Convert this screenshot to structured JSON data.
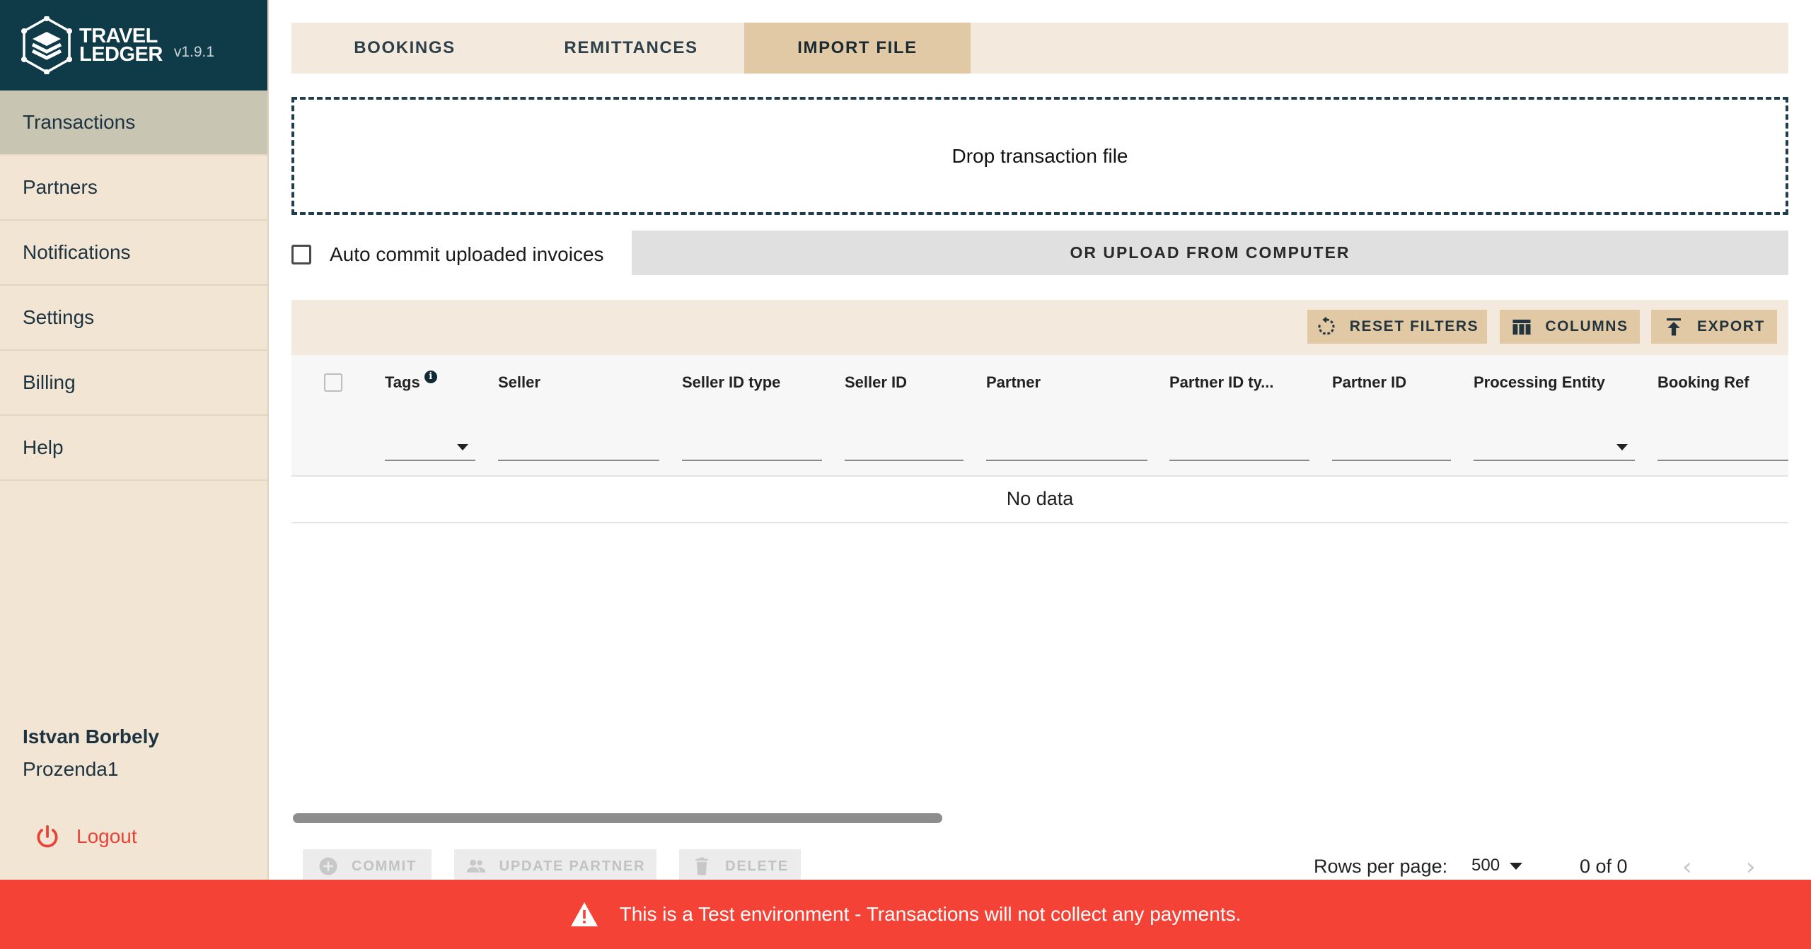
{
  "brand": {
    "name_line1": "TRAVEL",
    "name_line2": "LEDGER",
    "version": "v1.9.1"
  },
  "sidebar": {
    "items": [
      {
        "label": "Transactions",
        "active": true
      },
      {
        "label": "Partners"
      },
      {
        "label": "Notifications"
      },
      {
        "label": "Settings"
      },
      {
        "label": "Billing"
      },
      {
        "label": "Help"
      }
    ],
    "user_name": "Istvan Borbely",
    "user_org": "Prozenda1",
    "logout_label": "Logout"
  },
  "tabs": [
    {
      "label": "BOOKINGS"
    },
    {
      "label": "REMITTANCES"
    },
    {
      "label": "IMPORT FILE",
      "active": true
    }
  ],
  "dropzone": {
    "label": "Drop transaction file"
  },
  "auto_commit": {
    "label": "Auto commit uploaded invoices",
    "checked": false
  },
  "upload_button": "OR UPLOAD FROM COMPUTER",
  "toolbar": {
    "reset_filters": "RESET FILTERS",
    "columns": "COLUMNS",
    "export": "EXPORT"
  },
  "table": {
    "columns": [
      "Tags",
      "Seller",
      "Seller ID type",
      "Seller ID",
      "Partner",
      "Partner ID ty...",
      "Partner ID",
      "Processing Entity",
      "Booking Ref"
    ],
    "empty_text": "No data"
  },
  "actions": {
    "commit": "COMMIT",
    "update_partner": "UPDATE PARTNER",
    "delete": "DELETE"
  },
  "pagination": {
    "rows_per_page_label": "Rows per page:",
    "rows_per_page": "500",
    "count": "0 of 0"
  },
  "banner": {
    "text": "This is a Test environment - Transactions will not collect any payments."
  },
  "colors": {
    "sidebar_bg": "#f2e5d4",
    "brand_bg": "#0f3a47",
    "active_tab": "#e2c9a5",
    "banner_bg": "#f44336"
  }
}
